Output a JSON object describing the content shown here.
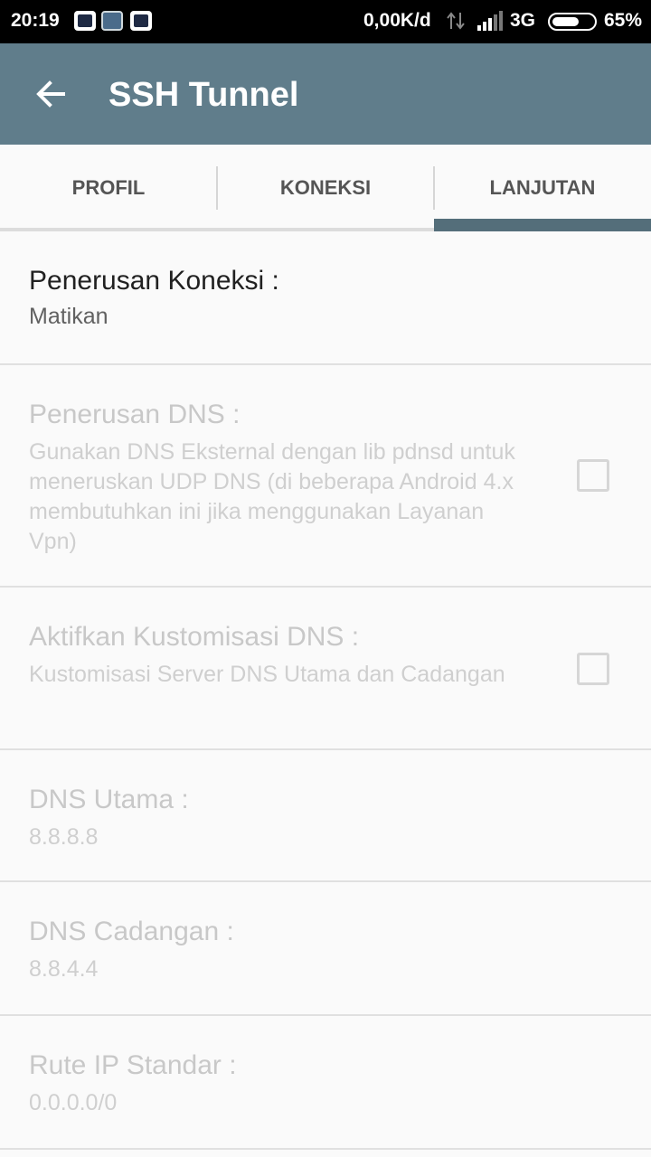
{
  "status_bar": {
    "time": "20:19",
    "notification_icons": [
      "bbm-icon",
      "game-icon",
      "bbm-icon"
    ],
    "net_speed": "0,00K/d",
    "network_type": "3G",
    "battery_percent": "65%",
    "battery_level": 0.65
  },
  "toolbar": {
    "title": "SSH Tunnel",
    "back_icon": "back-arrow-icon",
    "color": "#607d8b"
  },
  "tabs": {
    "items": [
      {
        "label": "PROFIL"
      },
      {
        "label": "KONEKSI"
      },
      {
        "label": "LANJUTAN"
      }
    ],
    "selected_index": 2,
    "indicator_color": "#546e7a"
  },
  "preferences": [
    {
      "title": "Penerusan Koneksi :",
      "summary": "Matikan",
      "enabled": true
    },
    {
      "title": "Penerusan DNS :",
      "summary": "Gunakan DNS Eksternal dengan lib pdnsd untuk meneruskan UDP DNS (di beberapa Android 4.x membutuhkan ini jika menggunakan Layanan Vpn)",
      "enabled": false,
      "checked": false
    },
    {
      "title": "Aktifkan Kustomisasi DNS :",
      "summary": "Kustomisasi Server DNS Utama dan Cadangan",
      "enabled": false,
      "checked": false
    },
    {
      "title": "DNS Utama :",
      "summary": "8.8.8.8",
      "enabled": false
    },
    {
      "title": "DNS Cadangan :",
      "summary": "8.8.4.4",
      "enabled": false
    },
    {
      "title": "Rute IP Standar :",
      "summary": "0.0.0.0/0",
      "enabled": false
    }
  ]
}
